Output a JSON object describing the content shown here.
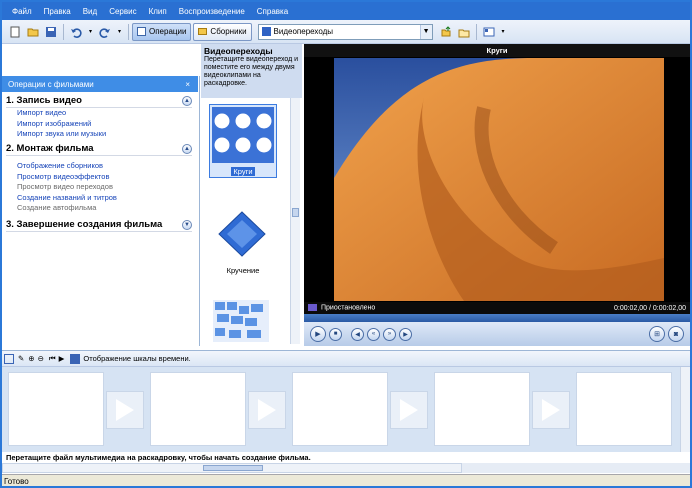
{
  "menu": [
    "Файл",
    "Правка",
    "Вид",
    "Сервис",
    "Клип",
    "Воспроизведение",
    "Справка"
  ],
  "toolbar": {
    "tasks_label": "Операции",
    "collections_label": "Сборники",
    "combo_value": "Видеопереходы"
  },
  "left": {
    "header": "Операции с фильмами",
    "close": "×",
    "sections": [
      {
        "title": "1. Запись видео",
        "links": [
          "Импорт видео",
          "Импорт изображений",
          "Импорт звука или музыки"
        ]
      },
      {
        "title": "2. Монтаж фильма",
        "links": [
          "Отображение сборников",
          "Просмотр видеоэффектов",
          "Просмотр видео переходов",
          "Создание названий и титров",
          "Создание автофильма"
        ]
      },
      {
        "title": "3. Завершение создания фильма",
        "links": []
      }
    ]
  },
  "middle": {
    "title": "Видеопереходы",
    "desc": "Перетащите видеопереход и поместите его между двумя видеоклипами на раскадровке.",
    "items": [
      "Круги",
      "Кручение"
    ]
  },
  "player": {
    "title": "Круги",
    "status": "Приостановлено",
    "time": "0:00:02,00 / 0:00:02,00"
  },
  "storyboard": {
    "timeline_label": "Отображение шкалы времени.",
    "hint": "Перетащите файл мультимедиа на раскадровку, чтобы начать создание фильма."
  },
  "statusbar": "Готово",
  "colors": {
    "menubar": "#2a70d2",
    "panel_header": "#3f8de6",
    "link": "#1644b8"
  }
}
